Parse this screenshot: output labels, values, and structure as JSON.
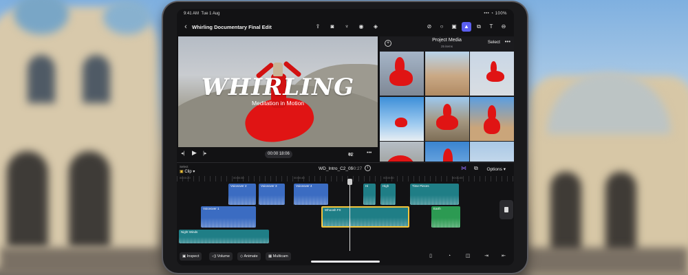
{
  "status": {
    "time": "9:41 AM",
    "date": "Tue 1 Aug",
    "indicators": "•••  ◔ 100%"
  },
  "header": {
    "title": "Whirling Documentary Final Edit",
    "icons": [
      "share-icon",
      "camera-icon",
      "microphone-icon",
      "record-icon",
      "paint-icon"
    ],
    "right_icons": [
      "slash-icon",
      "loop-icon",
      "photo-icon",
      "media-icon",
      "transition-icon",
      "text-icon",
      "more-icon"
    ]
  },
  "viewer": {
    "title": "WHIRLING",
    "subtitle": "Meditation in Motion",
    "timecode": "00:00 18:06",
    "zoom": "42",
    "zoom_unit": "%"
  },
  "media": {
    "title": "Project Media",
    "count": "25 items",
    "select_label": "Select",
    "more_label": "•••",
    "add_label": "+"
  },
  "timeline": {
    "clip_caption": "Select",
    "clip_label": "Clip",
    "project_name": "WD_Intro_C2_05",
    "duration": "00:27",
    "options_label": "Options",
    "ruler": [
      "00:00:20",
      "00:00:30",
      "00:00:40",
      "00:00:50",
      "00:01:00"
    ],
    "tracks": [
      {
        "label": "Voiceover 2",
        "kind": "blue"
      },
      {
        "label": "Voiceover 3",
        "kind": "blue"
      },
      {
        "label": "Voiceover 4",
        "kind": "blue"
      },
      {
        "label": "Hi",
        "kind": "teal"
      },
      {
        "label": "High",
        "kind": "teal"
      },
      {
        "label": "Time Pieces",
        "kind": "teal"
      },
      {
        "label": "Voiceover 1",
        "kind": "blue"
      },
      {
        "label": "Whoosh FX",
        "kind": "teal"
      },
      {
        "label": "Earth",
        "kind": "green"
      },
      {
        "label": "Night Winds",
        "kind": "teal"
      }
    ]
  },
  "bottombar": {
    "inspect_label": "Inspect",
    "volume_label": "Volume",
    "animate_label": "Animate",
    "multicam_label": "Multicam"
  },
  "colors": {
    "accent": "#5b5ff0",
    "selected": "#f3c43b",
    "clip_red": "#e01414"
  }
}
